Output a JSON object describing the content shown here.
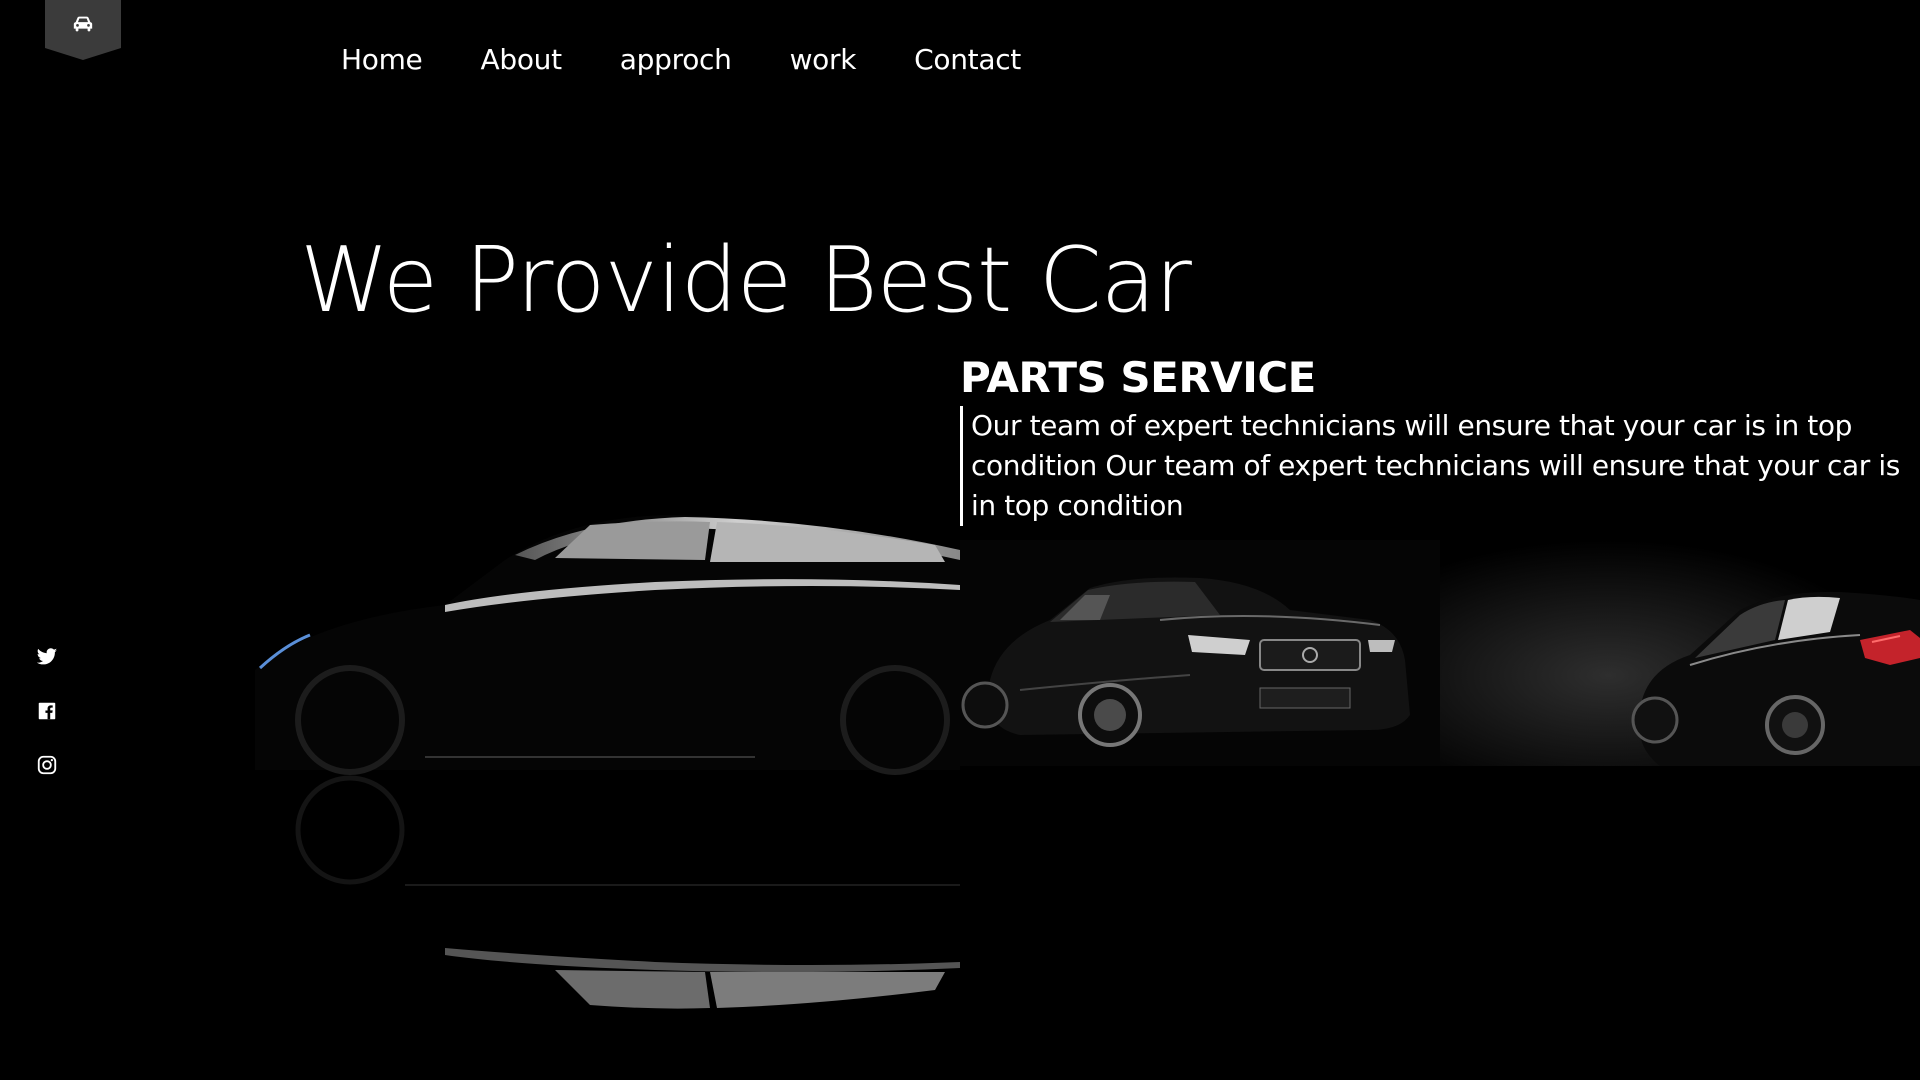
{
  "logo": {
    "icon": "car-icon"
  },
  "nav": {
    "items": [
      {
        "label": "Home"
      },
      {
        "label": "About"
      },
      {
        "label": "approch"
      },
      {
        "label": "work"
      },
      {
        "label": "Contact"
      }
    ]
  },
  "hero": {
    "headline": "We Provide Best Car"
  },
  "service": {
    "title": "PARTS SERVICE",
    "description": "Our team of expert technicians will ensure that your car is in top condition Our team of expert technicians will ensure that your car is in top condition"
  },
  "social": {
    "icons": [
      "twitter-icon",
      "facebook-icon",
      "instagram-icon"
    ]
  },
  "colors": {
    "background": "#000000",
    "text": "#ffffff",
    "logo_badge": "#3b3b3b"
  }
}
